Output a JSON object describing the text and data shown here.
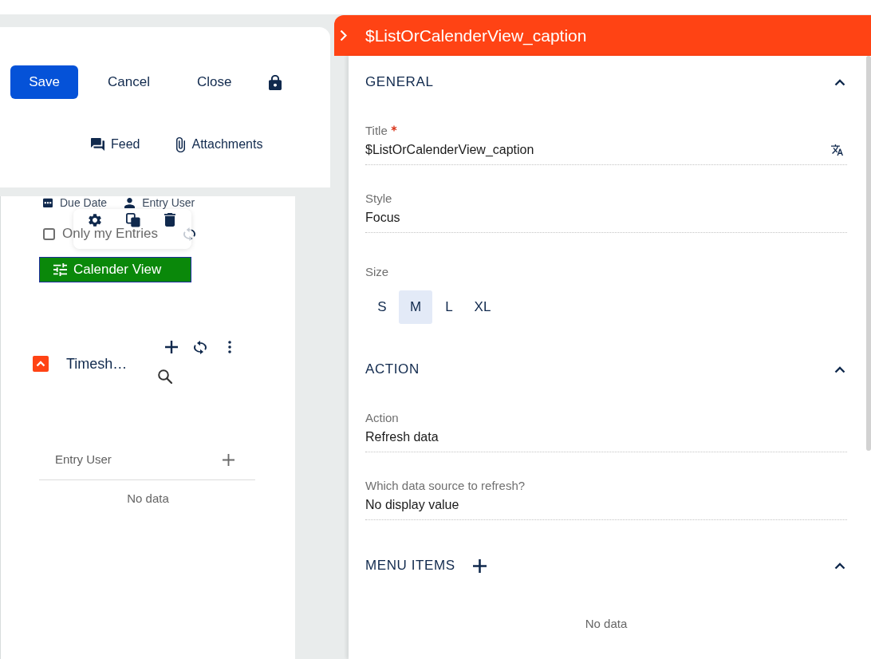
{
  "form_toolbar": {
    "buttons": [
      {
        "label": "Save",
        "kind": "save"
      },
      {
        "label": "Cancel",
        "kind": "cancel"
      },
      {
        "label": "Close",
        "kind": "close"
      }
    ]
  },
  "links": [
    {
      "label": "Feed",
      "kind": "feed"
    },
    {
      "label": "Attachments",
      "kind": "attachments"
    }
  ],
  "filter_options": [
    {
      "label": "Due Date",
      "kind": "date"
    },
    {
      "label": "Entry User",
      "kind": "user"
    }
  ],
  "only_my_entries": {
    "label": "Only my Entries",
    "checked": false
  },
  "calender_view_button": {
    "label": "Calender View",
    "selected": true
  },
  "timesheet": {
    "title": "Timesh…",
    "expanded": true,
    "columns": [
      {
        "label": "Entry User"
      }
    ],
    "empty_text": "No data"
  },
  "inspector": {
    "title": "$ListOrCalenderView_caption",
    "sections": [
      {
        "title": "GENERAL",
        "expanded": true,
        "addable": false,
        "fields": [
          {
            "kind": "text",
            "label": "Title",
            "required": true,
            "translatable": true,
            "value": "$ListOrCalenderView_caption"
          },
          {
            "kind": "text",
            "label": "Style",
            "required": false,
            "translatable": false,
            "value": "Focus"
          },
          {
            "kind": "size",
            "label": "Size",
            "required": false,
            "translatable": false,
            "options": [
              {
                "label": "S",
                "selected": false
              },
              {
                "label": "M",
                "selected": true
              },
              {
                "label": "L",
                "selected": false
              },
              {
                "label": "XL",
                "selected": false
              }
            ]
          }
        ]
      },
      {
        "title": "ACTION",
        "expanded": true,
        "addable": false,
        "fields": [
          {
            "kind": "text",
            "label": "Action",
            "required": false,
            "translatable": false,
            "value": "Refresh data"
          },
          {
            "kind": "text",
            "label": "Which data source to refresh?",
            "required": false,
            "translatable": false,
            "value": "No display value"
          }
        ]
      },
      {
        "title": "MENU ITEMS",
        "expanded": true,
        "addable": true,
        "empty_text": "No data"
      }
    ]
  }
}
